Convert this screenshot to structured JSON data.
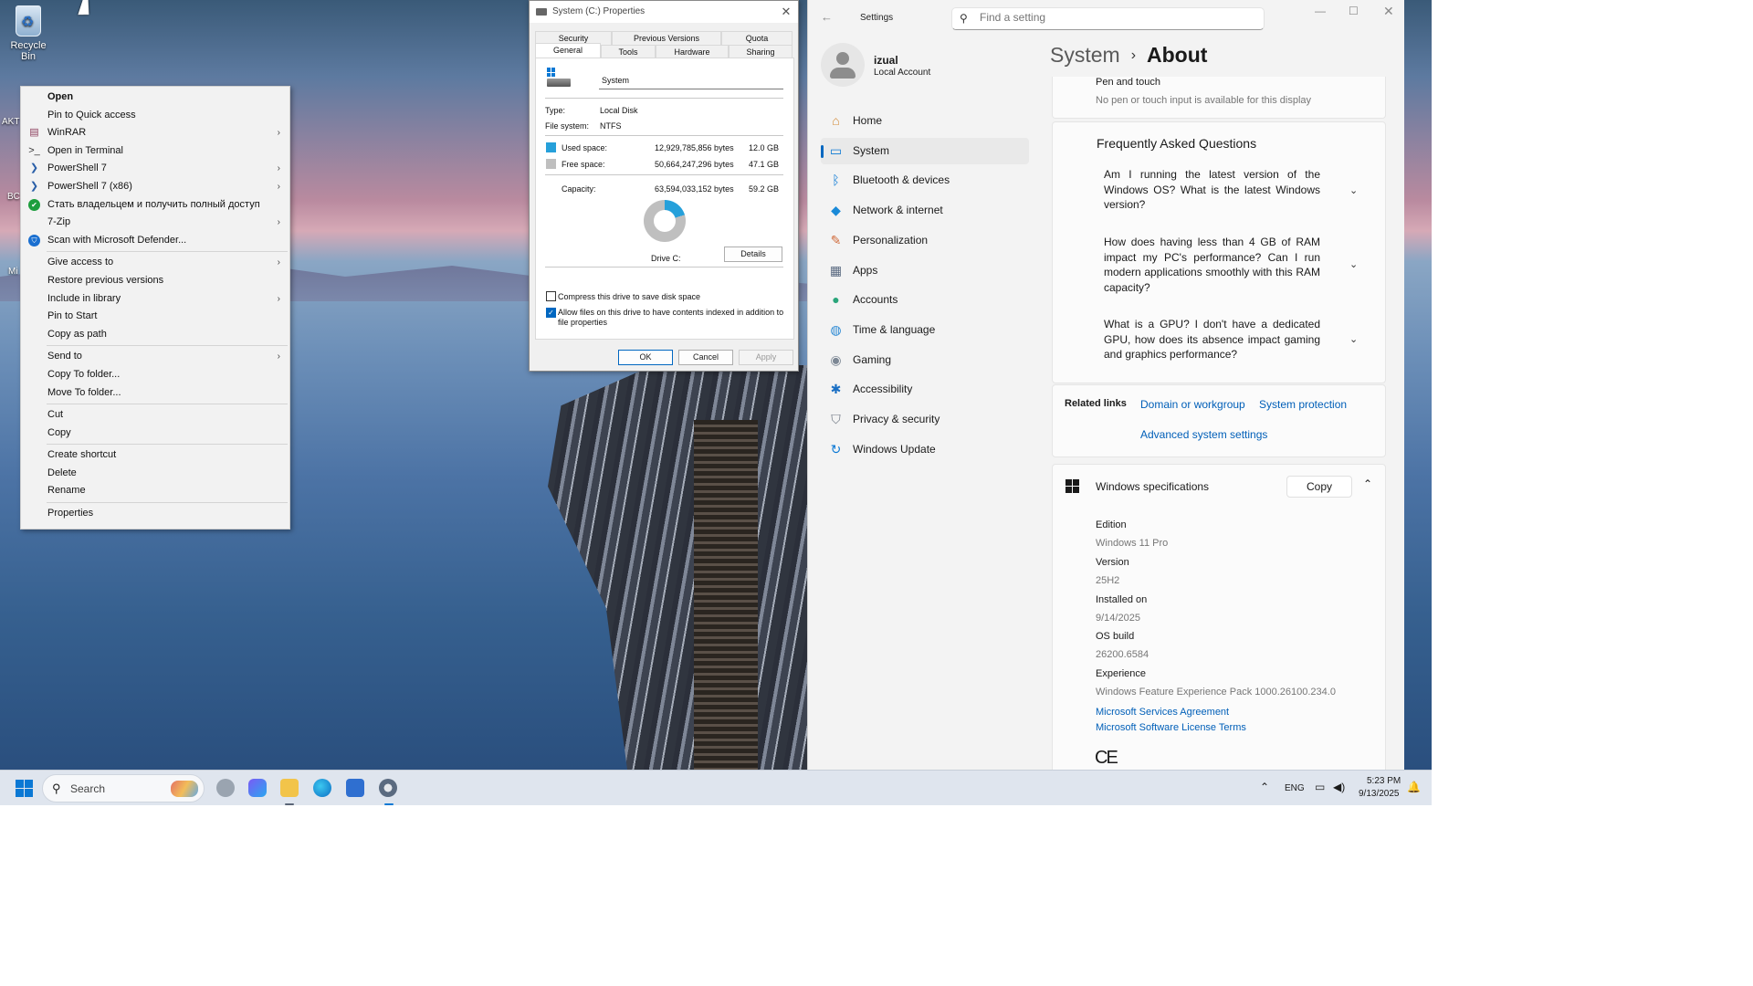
{
  "desktop": {
    "recycle_bin_label": "Recycle Bin",
    "partial_labels": [
      "AKT",
      "BC",
      "Mi"
    ]
  },
  "context_menu": {
    "items": [
      {
        "label": "Open",
        "bold": true,
        "icon": "",
        "submenu": false
      },
      {
        "label": "Pin to Quick access",
        "icon": "",
        "submenu": false
      },
      {
        "label": "WinRAR",
        "icon": "winrar-icon",
        "submenu": true
      },
      {
        "label": "Open in Terminal",
        "icon": "terminal-icon",
        "submenu": false
      },
      {
        "label": "PowerShell 7",
        "icon": "powershell-icon",
        "submenu": true
      },
      {
        "label": "PowerShell 7 (x86)",
        "icon": "powershell-icon",
        "submenu": true
      },
      {
        "label": "Стать владельцем и получить полный доступ",
        "icon": "shield-check-icon",
        "submenu": false
      },
      {
        "label": "7-Zip",
        "icon": "",
        "submenu": true
      },
      {
        "label": "Scan with Microsoft Defender...",
        "icon": "defender-icon",
        "submenu": false
      },
      {
        "sep": true
      },
      {
        "label": "Give access to",
        "icon": "",
        "submenu": true
      },
      {
        "label": "Restore previous versions",
        "icon": "",
        "submenu": false
      },
      {
        "label": "Include in library",
        "icon": "",
        "submenu": true
      },
      {
        "label": "Pin to Start",
        "icon": "",
        "submenu": false
      },
      {
        "label": "Copy as path",
        "icon": "",
        "submenu": false
      },
      {
        "sep": true
      },
      {
        "label": "Send to",
        "icon": "",
        "submenu": true
      },
      {
        "label": "Copy To folder...",
        "icon": "",
        "submenu": false
      },
      {
        "label": "Move To folder...",
        "icon": "",
        "submenu": false
      },
      {
        "sep": true
      },
      {
        "label": "Cut",
        "icon": "",
        "submenu": false
      },
      {
        "label": "Copy",
        "icon": "",
        "submenu": false
      },
      {
        "sep": true
      },
      {
        "label": "Create shortcut",
        "icon": "",
        "submenu": false
      },
      {
        "label": "Delete",
        "icon": "",
        "submenu": false
      },
      {
        "label": "Rename",
        "icon": "",
        "submenu": false
      },
      {
        "sep": true
      },
      {
        "label": "Properties",
        "icon": "",
        "submenu": false
      }
    ]
  },
  "properties": {
    "title": "System (C:) Properties",
    "tabs_row1": [
      "Security",
      "Previous Versions",
      "Quota"
    ],
    "tabs_row2": [
      "General",
      "Tools",
      "Hardware",
      "Sharing"
    ],
    "active_tab": "General",
    "drive_name": "System",
    "type_label": "Type:",
    "type_value": "Local Disk",
    "fs_label": "File system:",
    "fs_value": "NTFS",
    "used_label": "Used space:",
    "used_bytes": "12,929,785,856 bytes",
    "used_gb": "12.0 GB",
    "free_label": "Free space:",
    "free_bytes": "50,664,247,296 bytes",
    "free_gb": "47.1 GB",
    "cap_label": "Capacity:",
    "cap_bytes": "63,594,033,152 bytes",
    "cap_gb": "59.2 GB",
    "used_fraction": 0.203,
    "used_color": "#26a0da",
    "free_color": "#bfbfbf",
    "drive_label": "Drive C:",
    "details_button": "Details",
    "compress_label": "Compress this drive to save disk space",
    "compress_checked": false,
    "index_label": "Allow files on this drive to have contents indexed in addition to file properties",
    "index_checked": true,
    "ok": "OK",
    "cancel": "Cancel",
    "apply": "Apply"
  },
  "settings": {
    "app_title": "Settings",
    "search_placeholder": "Find a setting",
    "user_name": "izual",
    "user_type": "Local Account",
    "nav": [
      {
        "label": "Home",
        "icon": "home-icon",
        "color": "#d38b37"
      },
      {
        "label": "System",
        "icon": "system-icon",
        "color": "#0a78d4",
        "selected": true
      },
      {
        "label": "Bluetooth & devices",
        "icon": "bluetooth-icon",
        "color": "#0a78d4"
      },
      {
        "label": "Network & internet",
        "icon": "wifi-icon",
        "color": "#1a8ad8"
      },
      {
        "label": "Personalization",
        "icon": "brush-icon",
        "color": "#d06a3a"
      },
      {
        "label": "Apps",
        "icon": "apps-icon",
        "color": "#5a6a80"
      },
      {
        "label": "Accounts",
        "icon": "person-icon",
        "color": "#2aa57a"
      },
      {
        "label": "Time & language",
        "icon": "globe-icon",
        "color": "#2b89d4"
      },
      {
        "label": "Gaming",
        "icon": "gamepad-icon",
        "color": "#7c8794"
      },
      {
        "label": "Accessibility",
        "icon": "accessibility-icon",
        "color": "#1a6fc4"
      },
      {
        "label": "Privacy & security",
        "icon": "shield-icon",
        "color": "#6d7682"
      },
      {
        "label": "Windows Update",
        "icon": "update-icon",
        "color": "#0a78d4"
      }
    ],
    "breadcrumb_parent": "System",
    "breadcrumb_current": "About",
    "pen_title": "Pen and touch",
    "pen_value": "No pen or touch input is available for this display",
    "faq_title": "Frequently Asked Questions",
    "faqs": [
      "Am I running the latest version of the Windows OS? What is the latest Windows version?",
      "How does having less than 4 GB of RAM impact my PC's performance? Can I run modern applications smoothly with this RAM capacity?",
      "What is a GPU? I don't have a dedicated GPU, how does its absence impact gaming and graphics performance?"
    ],
    "related_label": "Related links",
    "related_links": [
      "Domain or workgroup",
      "System protection",
      "Advanced system settings"
    ],
    "spec_title": "Windows specifications",
    "copy_button": "Copy",
    "specs": [
      {
        "label": "Edition",
        "value": "Windows 11 Pro"
      },
      {
        "label": "Version",
        "value": "25H2"
      },
      {
        "label": "Installed on",
        "value": "9/14/2025"
      },
      {
        "label": "OS build",
        "value": "26200.6584"
      },
      {
        "label": "Experience",
        "value": "Windows Feature Experience Pack 1000.26100.234.0"
      }
    ],
    "spec_links": [
      "Microsoft Services Agreement",
      "Microsoft Software License Terms"
    ],
    "ce_mark": "CE"
  },
  "taskbar": {
    "search_label": "Search",
    "lang": "ENG",
    "time": "5:23 PM",
    "date": "9/13/2025"
  }
}
